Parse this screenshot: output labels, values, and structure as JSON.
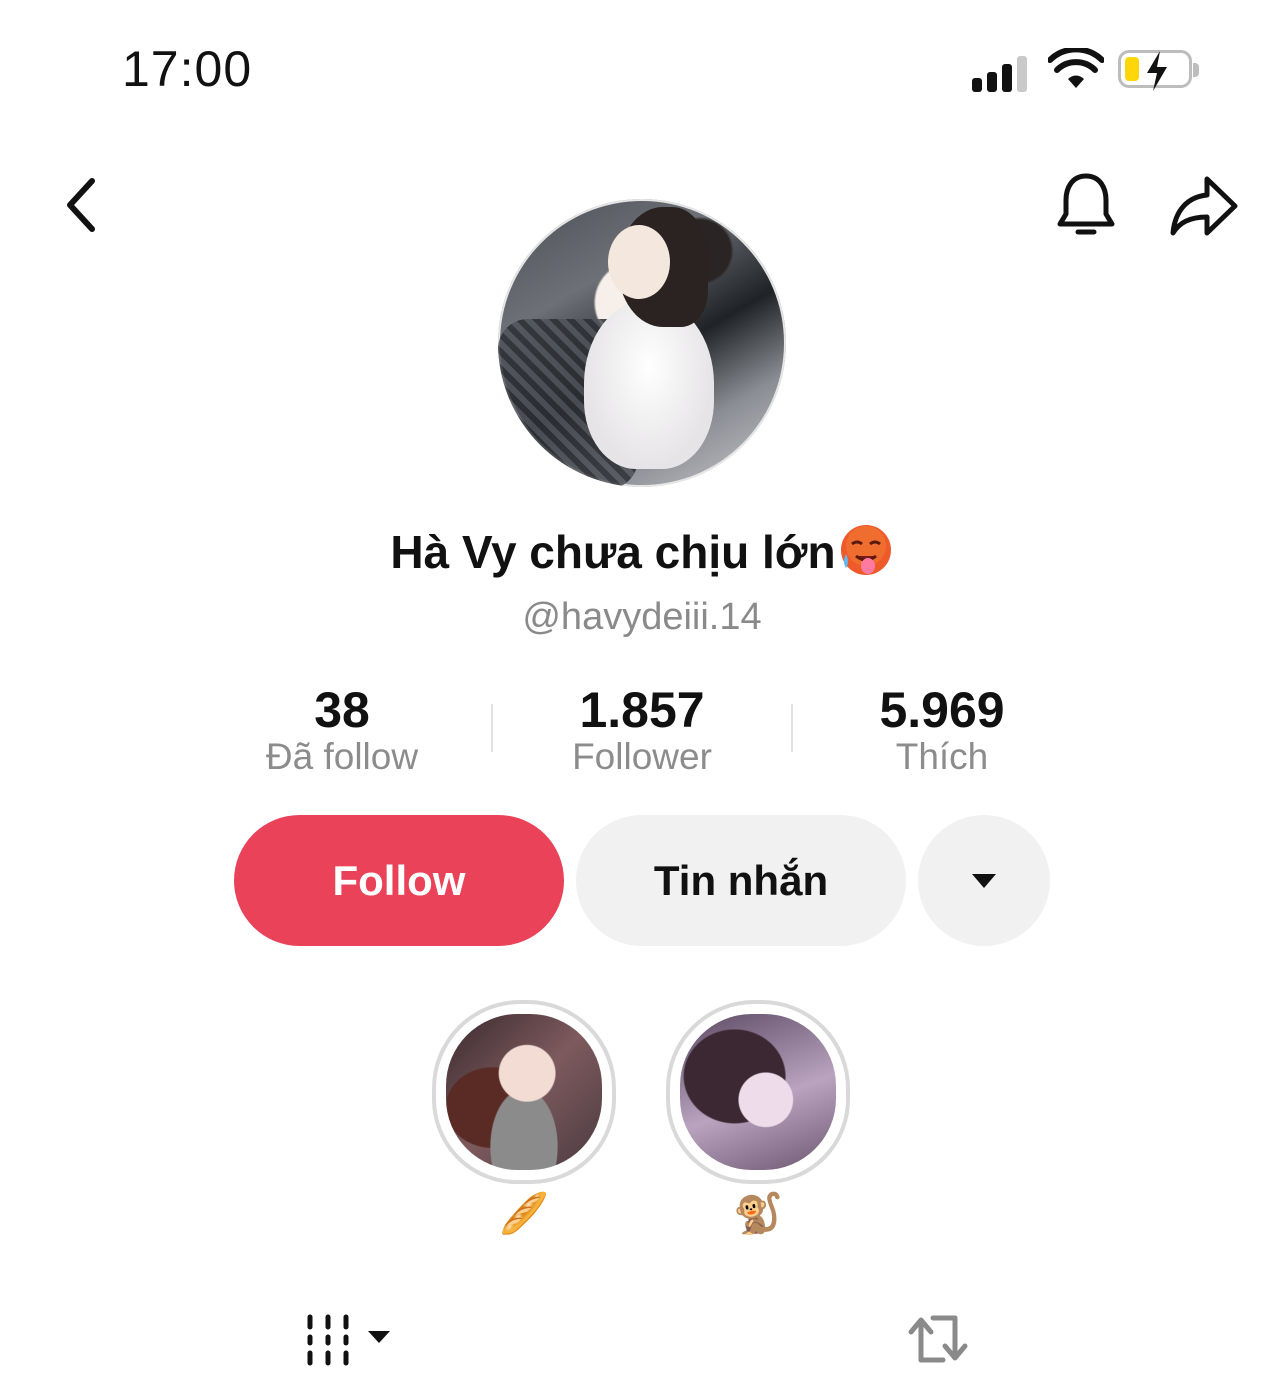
{
  "status_bar": {
    "time": "17:00"
  },
  "profile": {
    "display_name": "Hà Vy chưa chịu lớn",
    "handle": "@havydeiii.14"
  },
  "stats": [
    {
      "value": "38",
      "label": "Đã follow"
    },
    {
      "value": "1.857",
      "label": "Follower"
    },
    {
      "value": "5.969",
      "label": "Thích"
    }
  ],
  "actions": {
    "follow_label": "Follow",
    "message_label": "Tin nhắn"
  },
  "highlights": [
    {
      "label": "🥖"
    },
    {
      "label": "🐒"
    }
  ],
  "colors": {
    "follow": "#ea4359",
    "secondary_button": "#f1f1f2",
    "muted_text": "#8a8a8a"
  },
  "icons": [
    "back-icon",
    "bell-icon",
    "share-icon",
    "grid-sort-icon",
    "repost-icon",
    "chevron-down-icon"
  ]
}
